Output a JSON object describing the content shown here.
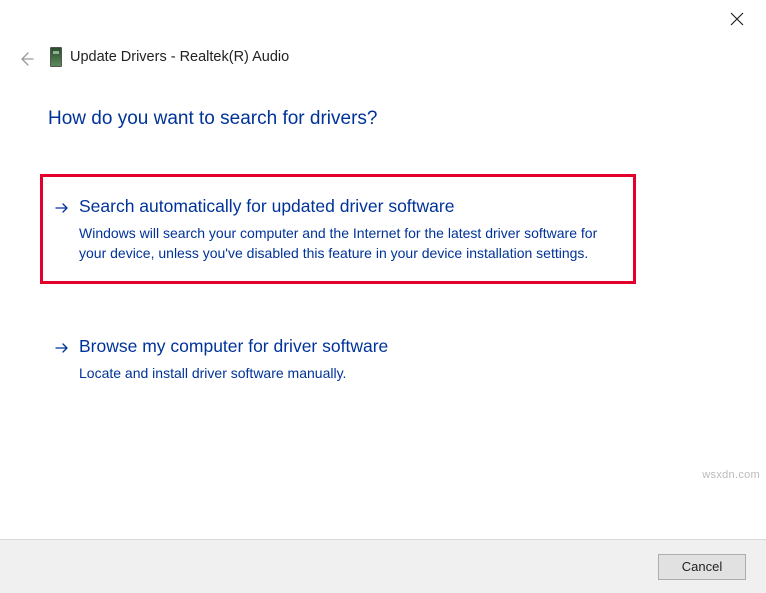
{
  "header": {
    "title": "Update Drivers - Realtek(R) Audio"
  },
  "heading": "How do you want to search for drivers?",
  "options": {
    "automatic": {
      "title": "Search automatically for updated driver software",
      "desc": "Windows will search your computer and the Internet for the latest driver software for your device, unless you've disabled this feature in your device installation settings."
    },
    "browse": {
      "title": "Browse my computer for driver software",
      "desc": "Locate and install driver software manually."
    }
  },
  "footer": {
    "cancel": "Cancel"
  },
  "watermark": "wsxdn.com"
}
